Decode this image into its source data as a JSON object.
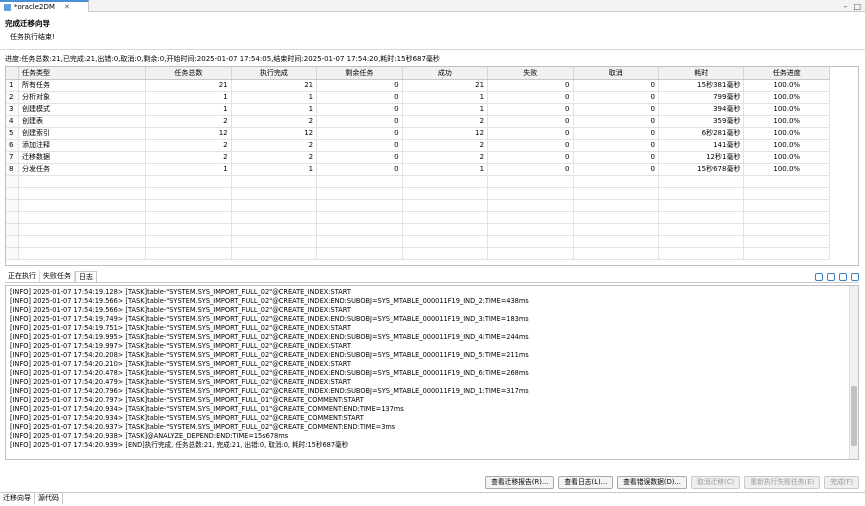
{
  "editor_tab": {
    "title": "*oracle2DM"
  },
  "wizard": {
    "title": "完成迁移向导",
    "subtitle": "任务执行结束!"
  },
  "summary": "进度:任务总数:21,已完成:21,出错:0,取消:0,剩余:0,开始时间:2025-01-07 17:54:05,结束时间:2025-01-07 17:54:20,耗时:15秒687毫秒",
  "table": {
    "columns": [
      "任务类型",
      "任务总数",
      "执行完成",
      "剩余任务",
      "成功",
      "失败",
      "取消",
      "耗时",
      "任务进度"
    ],
    "rows": [
      [
        "1",
        "所有任务",
        "21",
        "21",
        "0",
        "21",
        "0",
        "0",
        "15秒381毫秒",
        "100.0%"
      ],
      [
        "2",
        "分析对象",
        "1",
        "1",
        "0",
        "1",
        "0",
        "0",
        "799毫秒",
        "100.0%"
      ],
      [
        "3",
        "创建模式",
        "1",
        "1",
        "0",
        "1",
        "0",
        "0",
        "394毫秒",
        "100.0%"
      ],
      [
        "4",
        "创建表",
        "2",
        "2",
        "0",
        "2",
        "0",
        "0",
        "359毫秒",
        "100.0%"
      ],
      [
        "5",
        "创建索引",
        "12",
        "12",
        "0",
        "12",
        "0",
        "0",
        "6秒281毫秒",
        "100.0%"
      ],
      [
        "6",
        "添加注释",
        "2",
        "2",
        "0",
        "2",
        "0",
        "0",
        "141毫秒",
        "100.0%"
      ],
      [
        "7",
        "迁移数据",
        "2",
        "2",
        "0",
        "2",
        "0",
        "0",
        "12秒1毫秒",
        "100.0%"
      ],
      [
        "8",
        "分发任务",
        "1",
        "1",
        "0",
        "1",
        "0",
        "0",
        "15秒678毫秒",
        "100.0%"
      ]
    ]
  },
  "bottom_tabs": [
    "正在执行",
    "失败任务",
    "日志"
  ],
  "log": [
    "[INFO] 2025-01-07 17:54:19.128> [TASK]table-\"SYSTEM.SYS_IMPORT_FULL_02\"@CREATE_INDEX:START",
    "[INFO] 2025-01-07 17:54:19.566> [TASK]table-\"SYSTEM.SYS_IMPORT_FULL_02\"@CREATE_INDEX:END:SUBOBJ=SYS_MTABLE_000011F19_IND_2:TIME=438ms",
    "[INFO] 2025-01-07 17:54:19.566> [TASK]table-\"SYSTEM.SYS_IMPORT_FULL_02\"@CREATE_INDEX:START",
    "[INFO] 2025-01-07 17:54:19.749> [TASK]table-\"SYSTEM.SYS_IMPORT_FULL_02\"@CREATE_INDEX:END:SUBOBJ=SYS_MTABLE_000011F19_IND_3:TIME=183ms",
    "[INFO] 2025-01-07 17:54:19.751> [TASK]table-\"SYSTEM.SYS_IMPORT_FULL_02\"@CREATE_INDEX:START",
    "[INFO] 2025-01-07 17:54:19.995> [TASK]table-\"SYSTEM.SYS_IMPORT_FULL_02\"@CREATE_INDEX:END:SUBOBJ=SYS_MTABLE_000011F19_IND_4:TIME=244ms",
    "[INFO] 2025-01-07 17:54:19.997> [TASK]table-\"SYSTEM.SYS_IMPORT_FULL_02\"@CREATE_INDEX:START",
    "[INFO] 2025-01-07 17:54:20.208> [TASK]table-\"SYSTEM.SYS_IMPORT_FULL_02\"@CREATE_INDEX:END:SUBOBJ=SYS_MTABLE_000011F19_IND_5:TIME=211ms",
    "[INFO] 2025-01-07 17:54:20.210> [TASK]table-\"SYSTEM.SYS_IMPORT_FULL_02\"@CREATE_INDEX:START",
    "[INFO] 2025-01-07 17:54:20.478> [TASK]table-\"SYSTEM.SYS_IMPORT_FULL_02\"@CREATE_INDEX:END:SUBOBJ=SYS_MTABLE_000011F19_IND_6:TIME=268ms",
    "[INFO] 2025-01-07 17:54:20.479> [TASK]table-\"SYSTEM.SYS_IMPORT_FULL_02\"@CREATE_INDEX:START",
    "[INFO] 2025-01-07 17:54:20.796> [TASK]table-\"SYSTEM.SYS_IMPORT_FULL_02\"@CREATE_INDEX:END:SUBOBJ=SYS_MTABLE_000011F19_IND_1:TIME=317ms",
    "[INFO] 2025-01-07 17:54:20.797> [TASK]table-\"SYSTEM.SYS_IMPORT_FULL_01\"@CREATE_COMMENT:START",
    "[INFO] 2025-01-07 17:54:20.934> [TASK]table-\"SYSTEM.SYS_IMPORT_FULL_01\"@CREATE_COMMENT:END:TIME=137ms",
    "[INFO] 2025-01-07 17:54:20.934> [TASK]table-\"SYSTEM.SYS_IMPORT_FULL_02\"@CREATE_COMMENT:START",
    "[INFO] 2025-01-07 17:54:20.937> [TASK]table-\"SYSTEM.SYS_IMPORT_FULL_02\"@CREATE_COMMENT:END:TIME=3ms",
    "[INFO] 2025-01-07 17:54:20.938> [TASK]@ANALYZE_DEPEND:END:TIME=15s678ms",
    "[INFO] 2025-01-07 17:54:20.939> [END]执行完成, 任务总数:21, 完成:21, 出错:0, 取消:0, 耗时:15秒687毫秒"
  ],
  "buttons": {
    "view_report": "查看迁移报告(R)...",
    "view_log": "查看日志(L)...",
    "view_error": "查看错误数据(D)...",
    "cancel_migration": "取消迁移(C)",
    "reexecute": "重新执行失败任务(E)",
    "finish": "完成(F)"
  },
  "footer_tabs": [
    "迁移向导",
    "源代码"
  ]
}
